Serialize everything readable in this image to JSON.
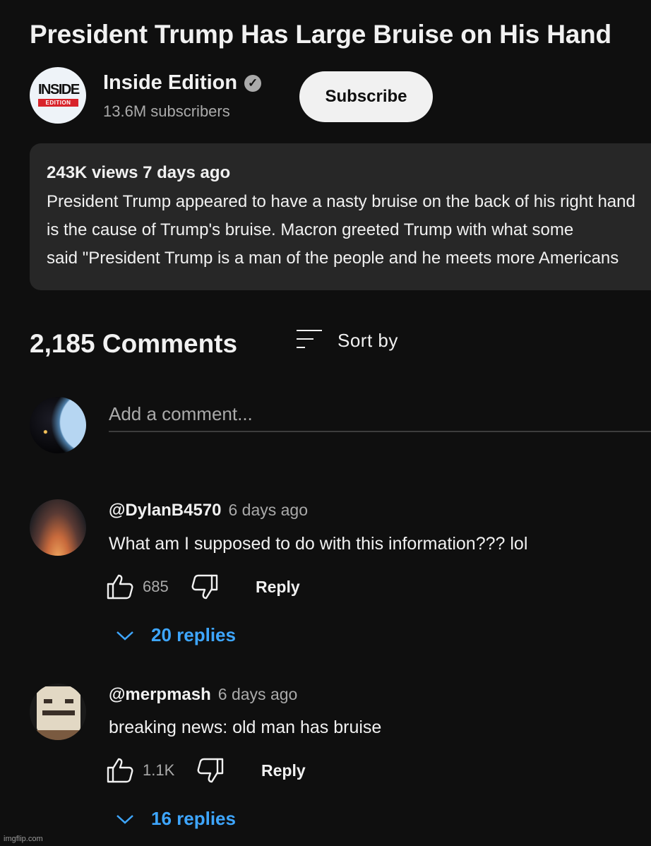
{
  "video": {
    "title": "President Trump Has Large Bruise on His Hand"
  },
  "channel": {
    "name": "Inside Edition",
    "subscribers": "13.6M subscribers",
    "logo_top": "INSIDE",
    "logo_bottom": "EDITION",
    "verified_icon": "check-circle-icon",
    "subscribe_label": "Subscribe"
  },
  "description": {
    "meta": "243K views  7 days ago",
    "lines": [
      "President Trump appeared to have a nasty bruise on the back of his right hand",
      "is the cause of Trump's bruise. Macron greeted Trump with what some",
      "said \"President Trump is a man of the people and he meets more Americans"
    ]
  },
  "comments_header": {
    "count": "2,185 Comments",
    "sort_label": "Sort by",
    "sort_icon": "sort-icon"
  },
  "add_comment": {
    "placeholder": "Add a comment..."
  },
  "comments": [
    {
      "author": "@DylanB4570",
      "time": "6 days ago",
      "text": "What am I supposed to do with this information??? lol",
      "likes": "685",
      "reply_label": "Reply",
      "replies": "20 replies"
    },
    {
      "author": "@merpmash",
      "time": "6 days ago",
      "text": "breaking news: old man has bruise",
      "likes": "1.1K",
      "reply_label": "Reply",
      "replies": "16 replies"
    }
  ],
  "watermark": "imgflip.com",
  "colors": {
    "background": "#0f0f0f",
    "panel": "#272727",
    "text": "#f1f1f1",
    "secondary_text": "#aaaaaa",
    "link": "#3ea6ff",
    "brand_red": "#d8232a"
  }
}
